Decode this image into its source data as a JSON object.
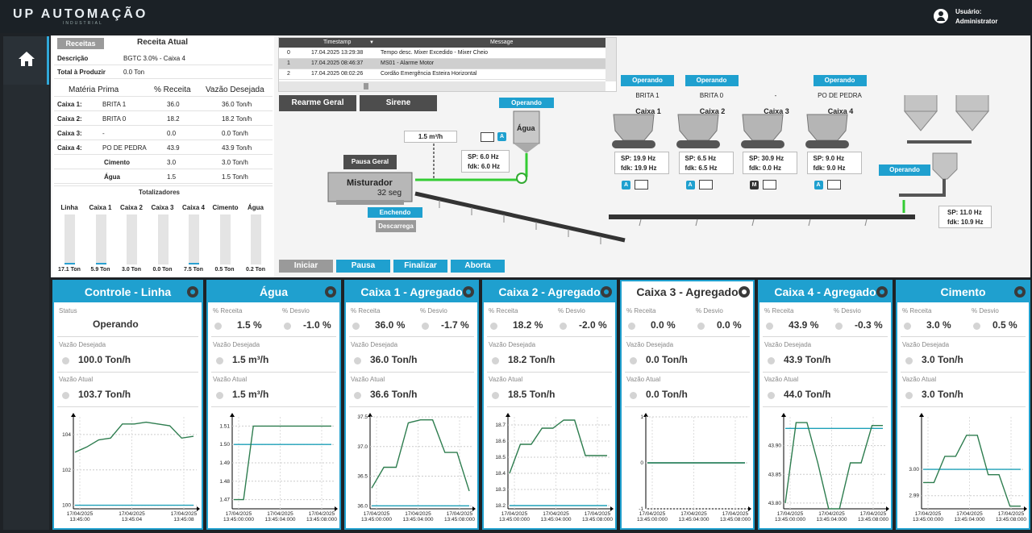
{
  "app": {
    "logo_main": "UP AUTOMAÇÃO",
    "logo_sub": "INDUSTRIAL",
    "user_label": "Usuário:",
    "user_name": "Administrator"
  },
  "recipe": {
    "tab_label": "Receitas",
    "current_title": "Receita Atual",
    "desc_label": "Descrição",
    "desc_value": "BGTC 3.0% - Caixa 4",
    "total_label": "Total à Produzir",
    "total_value": "0.0 Ton",
    "headers": [
      "Matéria Prima",
      "% Receita",
      "Vazão Desejada"
    ],
    "rows": [
      {
        "name": "Caixa 1:",
        "material": "BRITA 1",
        "pct": "36.0",
        "flow": "36.0 Ton/h"
      },
      {
        "name": "Caixa 2:",
        "material": "BRITA 0",
        "pct": "18.2",
        "flow": "18.2 Ton/h"
      },
      {
        "name": "Caixa 3:",
        "material": "-",
        "pct": "0.0",
        "flow": "0.0 Ton/h"
      },
      {
        "name": "Caixa 4:",
        "material": "PO DE PEDRA",
        "pct": "43.9",
        "flow": "43.9 Ton/h"
      },
      {
        "name": "Cimento",
        "material": "",
        "pct": "3.0",
        "flow": "3.0 Ton/h"
      },
      {
        "name": "Água",
        "material": "",
        "pct": "1.5",
        "flow": "1.5 Ton/h"
      }
    ],
    "totalizers_title": "Totalizadores",
    "totalizers": [
      {
        "name": "Linha",
        "value": "17.1 Ton",
        "fill": 0.03
      },
      {
        "name": "Caixa 1",
        "value": "5.9 Ton",
        "fill": 0.03
      },
      {
        "name": "Caixa 2",
        "value": "3.0 Ton",
        "fill": 0.0
      },
      {
        "name": "Caixa 3",
        "value": "0.0 Ton",
        "fill": 0.0
      },
      {
        "name": "Caixa 4",
        "value": "7.5 Ton",
        "fill": 0.03
      },
      {
        "name": "Cimento",
        "value": "0.5 Ton",
        "fill": 0.0
      },
      {
        "name": "Água",
        "value": "0.2 Ton",
        "fill": 0.0
      }
    ]
  },
  "alarms": {
    "col_timestamp": "Timestamp",
    "col_message": "Message",
    "rows": [
      {
        "idx": "0",
        "ts": "17.04.2025 13:29:38",
        "msg": "Tempo desc. Mixer Excedido - Mixer Cheio"
      },
      {
        "idx": "1",
        "ts": "17.04.2025 08:46:37",
        "msg": "MS01 - Alarme Motor"
      },
      {
        "idx": "2",
        "ts": "17.04.2025 08:02:26",
        "msg": "Cordão Emergência Esteira Horizontal"
      }
    ]
  },
  "controls": {
    "reset": "Rearme Geral",
    "siren": "Sirene",
    "pause_all": "Pausa Geral",
    "start": "Iniciar",
    "pause": "Pausa",
    "finish": "Finalizar",
    "abort": "Aborta"
  },
  "process": {
    "water_status": "Operando",
    "water_label": "Água",
    "water_flow": "1.5 m³/h",
    "water_sp": "SP:  6.0 Hz",
    "water_fdk": "fdk:  6.0 Hz",
    "mixer_label": "Misturador",
    "mixer_time": "32 seg",
    "mixer_state": "Enchendo",
    "mixer_discharge": "Descarrega",
    "cement_status": "Operando",
    "cement_sp": "SP: 11.0 Hz",
    "cement_fdk": "fdk: 10.9 Hz",
    "boxes": [
      {
        "status": "Operando",
        "material": "BRITA 1",
        "name": "Caixa 1",
        "sp": "SP: 19.9 Hz",
        "fdk": "fdk: 19.9 Hz",
        "mode": "A"
      },
      {
        "status": "Operando",
        "material": "BRITA 0",
        "name": "Caixa 2",
        "sp": "SP:  6.5 Hz",
        "fdk": "fdk:  6.5 Hz",
        "mode": "A"
      },
      {
        "status": "",
        "material": "-",
        "name": "Caixa 3",
        "sp": "SP: 30.9 Hz",
        "fdk": "fdk:  0.0 Hz",
        "mode": "M"
      },
      {
        "status": "Operando",
        "material": "PO DE PEDRA",
        "name": "Caixa 4",
        "sp": "SP:  9.0 Hz",
        "fdk": "fdk:  9.0 Hz",
        "mode": "A"
      }
    ],
    "mode_auto": "A"
  },
  "cards": [
    {
      "title": "Controle - Linha",
      "status_label": "Status",
      "status_value": "Operando",
      "l2": "Vazão Desejada",
      "v2": "100.0 Ton/h",
      "l3": "Vazão Atual",
      "v3": "103.7 Ton/h"
    },
    {
      "title": "Água",
      "pct_label": "% Receita",
      "dev_label": "% Desvio",
      "pct": "1.5 %",
      "dev": "-1.0 %",
      "l2": "Vazão Desejada",
      "v2": "1.5 m³/h",
      "l3": "Vazão Atual",
      "v3": "1.5 m³/h"
    },
    {
      "title": "Caixa 1 - Agregado",
      "pct_label": "% Receita",
      "dev_label": "% Desvio",
      "pct": "36.0 %",
      "dev": "-1.7 %",
      "l2": "Vazão Desejada",
      "v2": "36.0 Ton/h",
      "l3": "Vazão Atual",
      "v3": "36.6 Ton/h"
    },
    {
      "title": "Caixa 2 - Agregado",
      "pct_label": "% Receita",
      "dev_label": "% Desvio",
      "pct": "18.2 %",
      "dev": "-2.0 %",
      "l2": "Vazão Desejada",
      "v2": "18.2 Ton/h",
      "l3": "Vazão Atual",
      "v3": "18.5 Ton/h"
    },
    {
      "title": "Caixa 3 - Agregado",
      "pct_label": "% Receita",
      "dev_label": "% Desvio",
      "pct": "0.0 %",
      "dev": "0.0 %",
      "l2": "Vazão Desejada",
      "v2": "0.0 Ton/h",
      "l3": "Vazão Atual",
      "v3": "0.0 Ton/h"
    },
    {
      "title": "Caixa 4 - Agregado",
      "pct_label": "% Receita",
      "dev_label": "% Desvio",
      "pct": "43.9 %",
      "dev": "-0.3 %",
      "l2": "Vazão Desejada",
      "v2": "43.9 Ton/h",
      "l3": "Vazão Atual",
      "v3": "44.0 Ton/h"
    },
    {
      "title": "Cimento",
      "pct_label": "% Receita",
      "dev_label": "% Desvio",
      "pct": "3.0 %",
      "dev": "0.5 %",
      "l2": "Vazão Desejada",
      "v2": "3.0 Ton/h",
      "l3": "Vazão Atual",
      "v3": "3.0 Ton/h"
    }
  ],
  "chart_data": [
    {
      "type": "line",
      "title": "Controle - Linha",
      "ylim": [
        99.8,
        105
      ],
      "yticks": [
        "100",
        "102",
        "104"
      ],
      "xticks": [
        "17/04/2025 13:45:00",
        "17/04/2025 13:45:04",
        "17/04/2025 13:45:08"
      ],
      "grid": true,
      "series": [
        {
          "values": [
            103.0,
            103.3,
            103.7,
            103.8,
            104.6,
            104.6,
            104.7,
            104.6,
            104.5,
            103.8,
            103.9
          ]
        },
        {
          "values": [
            100.0,
            100.0,
            100.0,
            100.0,
            100.0,
            100.0,
            100.0,
            100.0,
            100.0,
            100.0,
            100.0
          ]
        }
      ]
    },
    {
      "type": "line",
      "title": "Água",
      "ylim": [
        1.465,
        1.515
      ],
      "yticks": [
        "1.47",
        "1.48",
        "1.49",
        "1.50",
        "1.51"
      ],
      "xticks": [
        "17/04/2025 13:45:00:000",
        "17/04/2025 13:45:04:000",
        "17/04/2025 13:45:08:000"
      ],
      "grid": true,
      "series": [
        {
          "values": [
            1.47,
            1.47,
            1.51,
            1.51,
            1.51,
            1.51,
            1.51,
            1.51,
            1.51,
            1.51,
            1.51
          ]
        },
        {
          "values": [
            1.5,
            1.5,
            1.5,
            1.5,
            1.5,
            1.5,
            1.5,
            1.5,
            1.5,
            1.5,
            1.5
          ]
        }
      ]
    },
    {
      "type": "line",
      "title": "Caixa 1 - Agregado",
      "ylim": [
        35.95,
        37.5
      ],
      "yticks": [
        "36.0",
        "36.5",
        "37.0",
        "37.5"
      ],
      "xticks": [
        "17/04/2025 13:45:00:000",
        "17/04/2025 13:45:04:000",
        "17/04/2025 13:45:08:000"
      ],
      "grid": true,
      "series": [
        {
          "values": [
            36.3,
            36.65,
            36.65,
            37.4,
            37.45,
            37.45,
            36.9,
            36.9,
            36.25
          ]
        },
        {
          "values": [
            36.0,
            36.0,
            36.0,
            36.0,
            36.0,
            36.0,
            36.0,
            36.0,
            36.0
          ]
        }
      ]
    },
    {
      "type": "line",
      "title": "Caixa 2 - Agregado",
      "ylim": [
        18.18,
        18.75
      ],
      "yticks": [
        "18.2",
        "18.3",
        "18.4",
        "18.5",
        "18.6",
        "18.7"
      ],
      "xticks": [
        "17/04/2025 13:45:00:000",
        "17/04/2025 13:45:04:000",
        "17/04/2025 13:45:08:000"
      ],
      "grid": true,
      "series": [
        {
          "values": [
            18.4,
            18.58,
            18.58,
            18.68,
            18.68,
            18.73,
            18.73,
            18.51,
            18.51,
            18.51
          ]
        },
        {
          "values": [
            18.2,
            18.2,
            18.2,
            18.2,
            18.2,
            18.2,
            18.2,
            18.2,
            18.2,
            18.2
          ]
        }
      ]
    },
    {
      "type": "line",
      "title": "Caixa 3 - Agregado",
      "ylim": [
        -1,
        1
      ],
      "yticks": [
        "-1",
        "0",
        "1"
      ],
      "xticks": [
        "17/04/2025 13:45:00:000",
        "17/04/2025 13:45:04:000",
        "17/04/2025 13:45:08:000"
      ],
      "grid": true,
      "series": [
        {
          "values": [
            0,
            0,
            0,
            0,
            0,
            0,
            0,
            0,
            0
          ]
        },
        {
          "values": [
            0,
            0,
            0,
            0,
            0,
            0,
            0,
            0,
            0
          ]
        }
      ]
    },
    {
      "type": "line",
      "title": "Caixa 4 - Agregado",
      "ylim": [
        43.79,
        43.95
      ],
      "yticks": [
        "43.80",
        "43.85",
        "43.90"
      ],
      "xticks": [
        "17/04/2025 13:45:00:000",
        "17/04/2025 13:45:04:000",
        "17/04/2025 13:45:08:000"
      ],
      "grid": true,
      "series": [
        {
          "values": [
            43.8,
            43.94,
            43.94,
            43.87,
            43.79,
            43.79,
            43.87,
            43.87,
            43.935,
            43.935
          ]
        },
        {
          "values": [
            43.93,
            43.93,
            43.93,
            43.93,
            43.93,
            43.93,
            43.93,
            43.93,
            43.93,
            43.93
          ]
        }
      ]
    },
    {
      "type": "line",
      "title": "Cimento",
      "ylim": [
        2.985,
        3.02
      ],
      "yticks": [
        "2.99",
        "3.00"
      ],
      "xticks": [
        "17/04/2025 13:45:00:000",
        "17/04/2025 13:45:04:000",
        "17/04/2025 13:45:08:000"
      ],
      "grid": true,
      "series": [
        {
          "values": [
            2.995,
            2.995,
            3.005,
            3.005,
            3.013,
            3.013,
            2.998,
            2.998,
            2.986,
            2.986
          ]
        },
        {
          "values": [
            3.0,
            3.0,
            3.0,
            3.0,
            3.0,
            3.0,
            3.0,
            3.0,
            3.0,
            3.0
          ]
        }
      ]
    }
  ]
}
